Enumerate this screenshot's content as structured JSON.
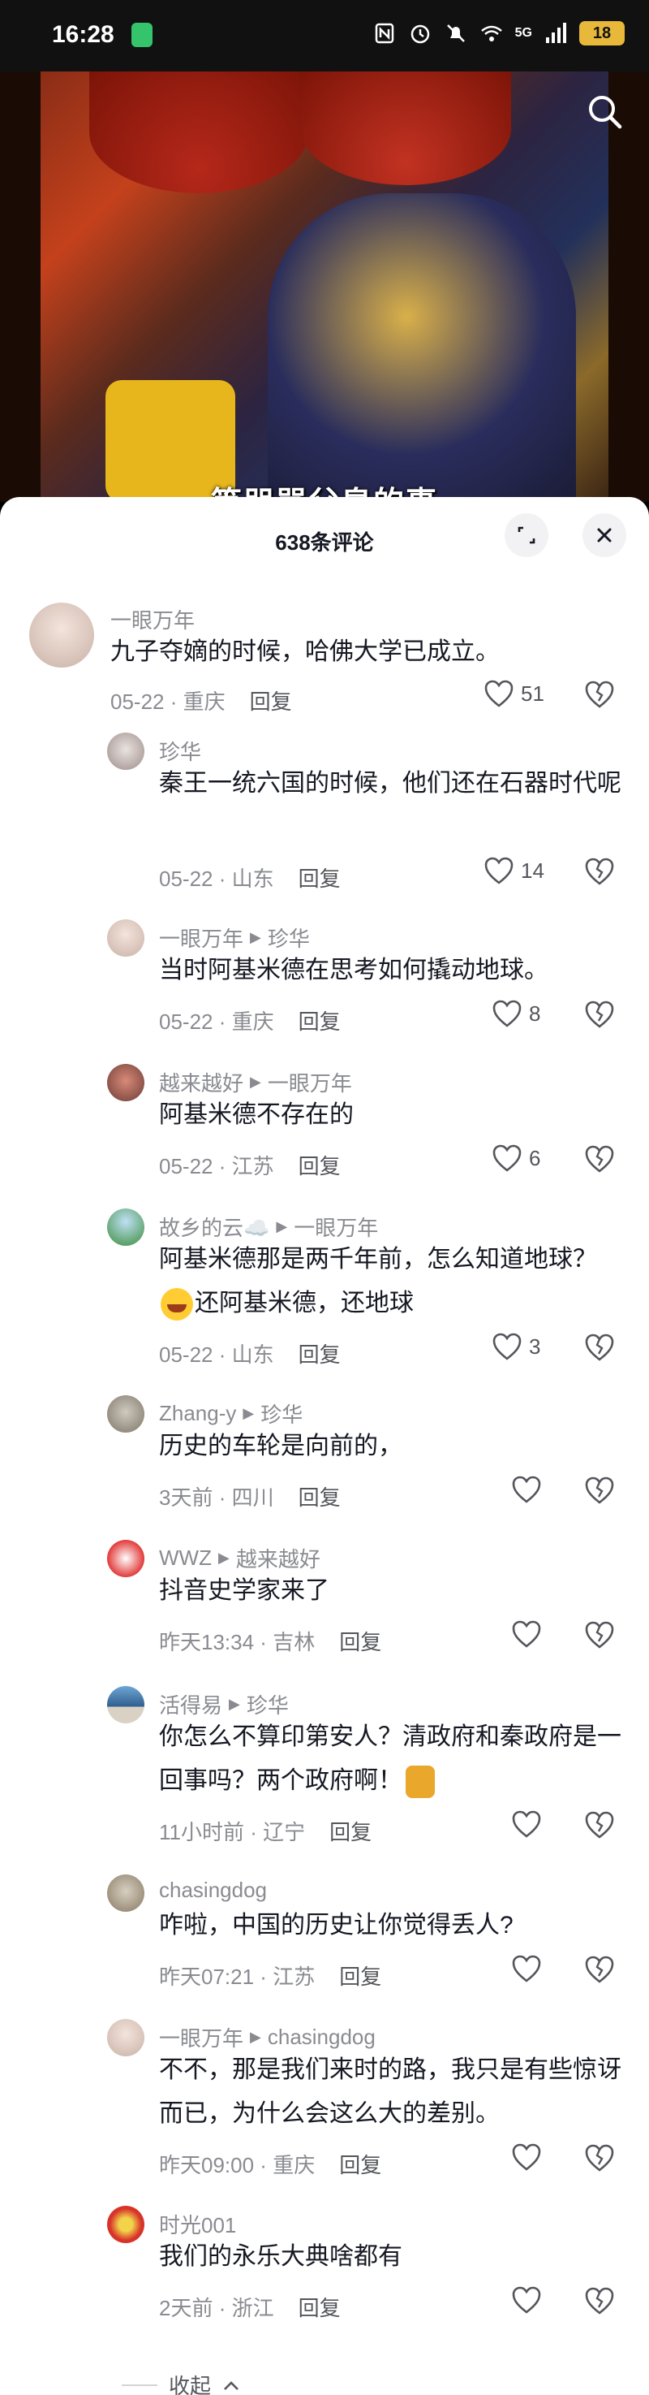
{
  "status_bar": {
    "time": "16:28",
    "network_label": "5G",
    "battery": "18"
  },
  "video": {
    "subtitle": "等咒骂父皇的事"
  },
  "comments_panel": {
    "title": "638条评论",
    "collapse_label": "收起"
  },
  "comments": [
    {
      "user": "一眼万年",
      "reply_to": "",
      "text": "九子夺嫡的时候，哈佛大学已成立。",
      "date": "05-22",
      "location": "重庆",
      "reply": "回复",
      "likes": "51"
    },
    {
      "user": "珍华",
      "reply_to": "",
      "text": "秦王一统六国的时候，他们还在石器时代呢",
      "date": "05-22",
      "location": "山东",
      "reply": "回复",
      "likes": "14"
    },
    {
      "user": "一眼万年",
      "reply_to": "珍华",
      "text": "当时阿基米德在思考如何撬动地球。",
      "date": "05-22",
      "location": "重庆",
      "reply": "回复",
      "likes": "8"
    },
    {
      "user": "越来越好",
      "reply_to": "一眼万年",
      "text": "阿基米德不存在的",
      "date": "05-22",
      "location": "江苏",
      "reply": "回复",
      "likes": "6"
    },
    {
      "user": "故乡的云☁️",
      "reply_to": "一眼万年",
      "text_a": "阿基米德那是两千年前，怎么知道地球？",
      "text_b": "还阿基米德，还地球",
      "date": "05-22",
      "location": "山东",
      "reply": "回复",
      "likes": "3"
    },
    {
      "user": "Zhang-y",
      "reply_to": "珍华",
      "text": "历史的车轮是向前的，",
      "date": "3天前",
      "location": "四川",
      "reply": "回复",
      "likes": ""
    },
    {
      "user": "WWZ",
      "reply_to": "越来越好",
      "text": "抖音史学家来了",
      "date": "昨天13:34",
      "location": "吉林",
      "reply": "回复",
      "likes": ""
    },
    {
      "user": "活得易",
      "reply_to": "珍华",
      "text": "你怎么不算印第安人？清政府和秦政府是一回事吗？两个政府啊！",
      "date": "11小时前",
      "location": "辽宁",
      "reply": "回复",
      "likes": ""
    },
    {
      "user": "chasingdog",
      "reply_to": "",
      "text": "咋啦，中国的历史让你觉得丢人?",
      "date": "昨天07:21",
      "location": "江苏",
      "reply": "回复",
      "likes": ""
    },
    {
      "user": "一眼万年",
      "reply_to": "chasingdog",
      "text": "不不，那是我们来时的路，我只是有些惊讶而已，为什么会这么大的差别。",
      "date": "昨天09:00",
      "location": "重庆",
      "reply": "回复",
      "likes": ""
    },
    {
      "user": "时光001",
      "reply_to": "",
      "text": "我们的永乐大典啥都有",
      "date": "2天前",
      "location": "浙江",
      "reply": "回复",
      "likes": ""
    }
  ],
  "colors": {
    "text_primary": "#161823",
    "text_secondary": "#8a8b91",
    "sheet_bg": "#ffffff",
    "button_bg": "#f2f2f4"
  },
  "icons": [
    "search-icon",
    "expand-icon",
    "close-icon",
    "heart-icon",
    "dislike-heart-icon",
    "chevron-up-icon"
  ]
}
